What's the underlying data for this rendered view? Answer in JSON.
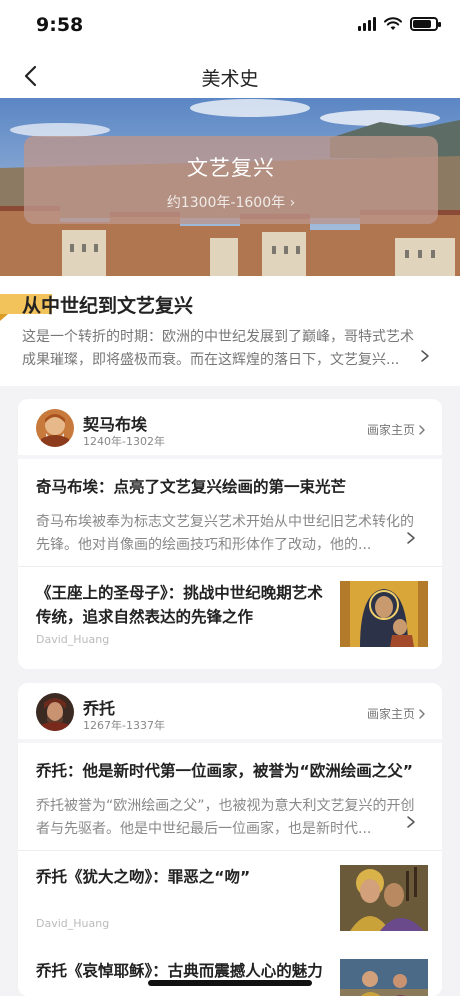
{
  "status_bar": {
    "time": "9:58"
  },
  "nav": {
    "title": "美术史"
  },
  "hero": {
    "title": "文艺复兴",
    "period": "约1300年-1600年 ›"
  },
  "intro": {
    "title": "从中世纪到文艺复兴",
    "text": "这是一个转折的时期：欧洲的中世纪发展到了巅峰，哥特式艺术成果璀璨，即将盛极而衰。而在这辉煌的落日下，文艺复兴..."
  },
  "painters": [
    {
      "name": "契马布埃",
      "years": "1240年-1302年",
      "home_link": "画家主页",
      "feature": {
        "title": "奇马布埃：点亮了文艺复兴绘画的第一束光芒",
        "text": "奇马布埃被奉为标志文艺复兴艺术开始从中世纪旧艺术转化的先锋。他对肖像画的绘画技巧和形体作了改动，他的..."
      },
      "articles": [
        {
          "title": "《王座上的圣母子》：挑战中世纪晚期艺术传统，追求自然表达的先锋之作",
          "author": "David_Huang"
        }
      ]
    },
    {
      "name": "乔托",
      "years": "1267年-1337年",
      "home_link": "画家主页",
      "feature": {
        "title": "乔托：他是新时代第一位画家，被誉为“欧洲绘画之父”",
        "text": "乔托被誉为“欧洲绘画之父”，也被视为意大利文艺复兴的开创者与先驱者。他是中世纪最后一位画家，也是新时代..."
      },
      "articles": [
        {
          "title": "乔托《犹大之吻》：罪恶之“吻”",
          "author": "David_Huang"
        },
        {
          "title": "乔托《哀悼耶稣》：古典而震撼人心的魅力",
          "author": ""
        }
      ]
    }
  ],
  "icons": {
    "back": "chevron-left-icon",
    "more": "chevron-right-icon",
    "signal": "signal-icon",
    "wifi": "wifi-icon",
    "battery": "battery-icon"
  },
  "colors": {
    "accent": "#f3c35b",
    "hero_overlay": "#be968c"
  }
}
